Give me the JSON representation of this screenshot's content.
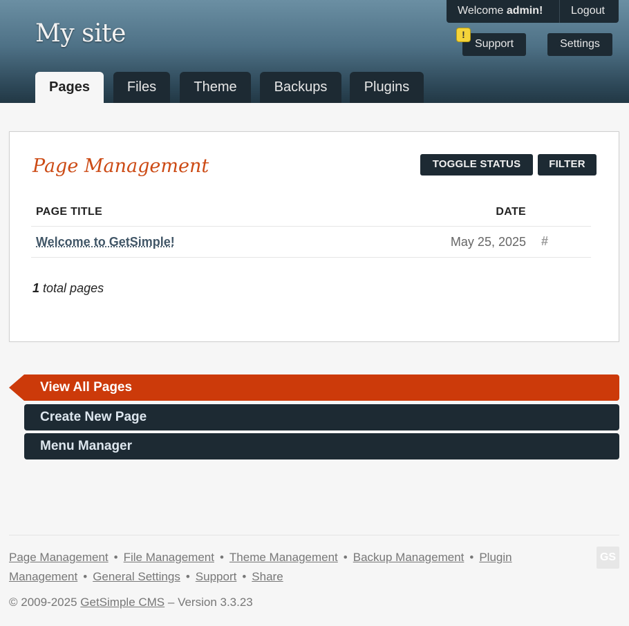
{
  "header": {
    "site_name": "My site",
    "welcome_prefix": "Welcome",
    "username": "admin!",
    "logout": "Logout",
    "support": "Support",
    "settings": "Settings",
    "warning_badge": "!",
    "tabs": [
      {
        "label": "Pages",
        "active": true
      },
      {
        "label": "Files"
      },
      {
        "label": "Theme"
      },
      {
        "label": "Backups"
      },
      {
        "label": "Plugins"
      }
    ]
  },
  "main": {
    "title": "Page Management",
    "toggle_status": "TOGGLE STATUS",
    "filter": "FILTER",
    "columns": {
      "title": "PAGE TITLE",
      "date": "DATE"
    },
    "rows": [
      {
        "title": "Welcome to GetSimple!",
        "date": "May 25, 2025",
        "link": "#"
      }
    ],
    "total_count": "1",
    "total_label": "total pages"
  },
  "sidebar": {
    "items": [
      {
        "label": "View All Pages",
        "current": true
      },
      {
        "label": "Create New Page"
      },
      {
        "label": "Menu Manager"
      }
    ]
  },
  "footer": {
    "links": [
      "Page Management",
      "File Management",
      "Theme Management",
      "Backup Management",
      "Plugin Management",
      "General Settings",
      "Support",
      "Share"
    ],
    "separator": "•",
    "copyright_prefix": "© 2009-2025",
    "brand": "GetSimple CMS",
    "version": "– Version 3.3.23",
    "logo": "GS"
  },
  "colors": {
    "accent": "#cc3a0a",
    "dark": "#1d2a33",
    "title": "#cc4a14"
  }
}
